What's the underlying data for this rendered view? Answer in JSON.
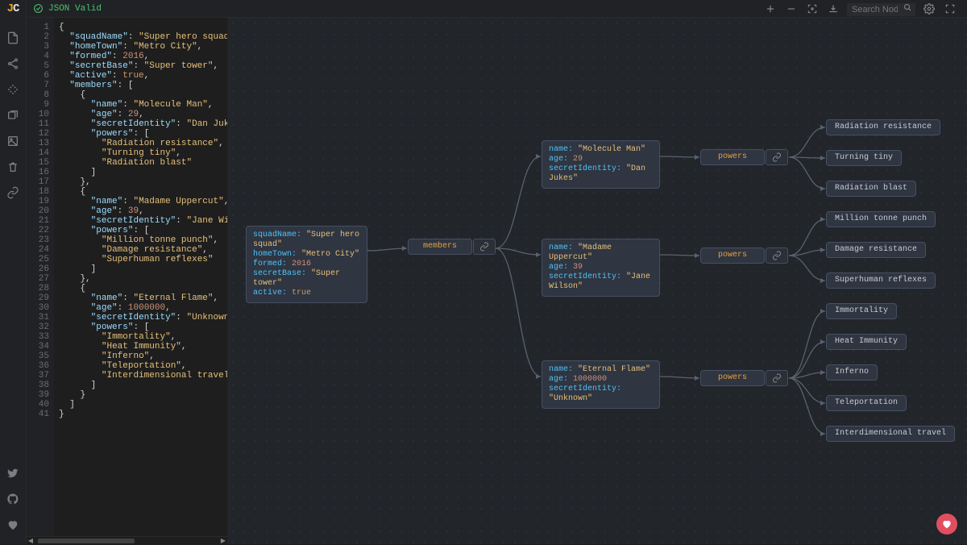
{
  "app": {
    "status": "JSON Valid",
    "search_placeholder": "Search Node"
  },
  "json": {
    "squadName": "Super hero squad",
    "homeTown": "Metro City",
    "formed": 2016,
    "secretBase": "Super tower",
    "active": true,
    "members": [
      {
        "name": "Molecule Man",
        "age": 29,
        "secretIdentity": "Dan Jukes",
        "powers": [
          "Radiation resistance",
          "Turning tiny",
          "Radiation blast"
        ]
      },
      {
        "name": "Madame Uppercut",
        "age": 39,
        "secretIdentity": "Jane Wilson",
        "powers": [
          "Million tonne punch",
          "Damage resistance",
          "Superhuman reflexes"
        ]
      },
      {
        "name": "Eternal Flame",
        "age": 1000000,
        "secretIdentity": "Unknown",
        "powers": [
          "Immortality",
          "Heat Immunity",
          "Inferno",
          "Teleportation",
          "Interdimensional travel"
        ]
      }
    ]
  },
  "labels": {
    "members": "members",
    "powers": "powers"
  },
  "code_lines": [
    "{",
    "  \"squadName\": \"Super hero squad\",",
    "  \"homeTown\": \"Metro City\",",
    "  \"formed\": 2016,",
    "  \"secretBase\": \"Super tower\",",
    "  \"active\": true,",
    "  \"members\": [",
    "    {",
    "      \"name\": \"Molecule Man\",",
    "      \"age\": 29,",
    "      \"secretIdentity\": \"Dan Jukes\",",
    "      \"powers\": [",
    "        \"Radiation resistance\",",
    "        \"Turning tiny\",",
    "        \"Radiation blast\"",
    "      ]",
    "    },",
    "    {",
    "      \"name\": \"Madame Uppercut\",",
    "      \"age\": 39,",
    "      \"secretIdentity\": \"Jane Wilson\",",
    "      \"powers\": [",
    "        \"Million tonne punch\",",
    "        \"Damage resistance\",",
    "        \"Superhuman reflexes\"",
    "      ]",
    "    },",
    "    {",
    "      \"name\": \"Eternal Flame\",",
    "      \"age\": 1000000,",
    "      \"secretIdentity\": \"Unknown\",",
    "      \"powers\": [",
    "        \"Immortality\",",
    "        \"Heat Immunity\",",
    "        \"Inferno\",",
    "        \"Teleportation\",",
    "        \"Interdimensional travel\"",
    "      ]",
    "    }",
    "  ]",
    "}"
  ]
}
